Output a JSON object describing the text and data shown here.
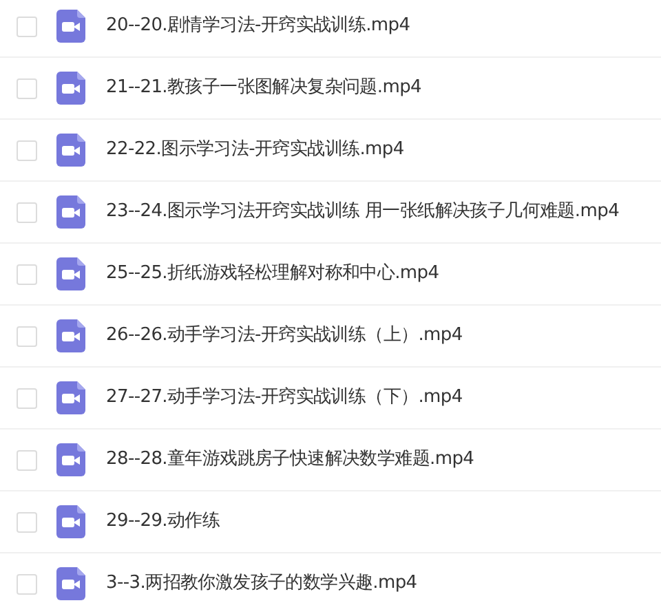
{
  "files": [
    {
      "name": "20--20.剧情学习法-开窍实战训练.mp4",
      "checked": false
    },
    {
      "name": "21--21.教孩子一张图解决复杂问题.mp4",
      "checked": false
    },
    {
      "name": "22-22.图示学习法-开窍实战训练.mp4",
      "checked": false
    },
    {
      "name": "23--24.图示学习法开窍实战训练 用一张纸解决孩子几何难题.mp4",
      "checked": false
    },
    {
      "name": "25--25.折纸游戏轻松理解对称和中心.mp4",
      "checked": false
    },
    {
      "name": "26--26.动手学习法-开窍实战训练（上）.mp4",
      "checked": false
    },
    {
      "name": "27--27.动手学习法-开窍实战训练（下）.mp4",
      "checked": false
    },
    {
      "name": "28--28.童年游戏跳房子快速解决数学难题.mp4",
      "checked": false
    },
    {
      "name": "29--29.动作练",
      "checked": false
    },
    {
      "name": "3--3.两招教你激发孩子的数学兴趣.mp4",
      "checked": false
    }
  ]
}
